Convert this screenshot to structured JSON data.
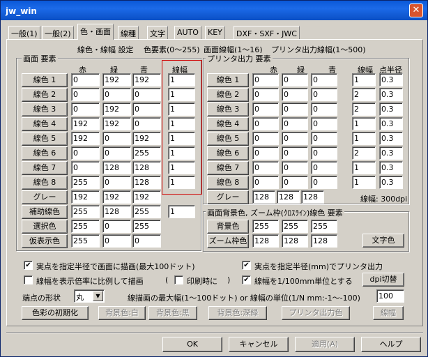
{
  "window": {
    "title": "jw_win",
    "close_glyph": "✕"
  },
  "tabs": [
    "一般(1)",
    "一般(2)",
    "色・画面",
    "線種",
    "文字",
    "AUTO",
    "KEY",
    "DXF・SXF・JWC"
  ],
  "header": {
    "line1": "線色・線幅 設定",
    "line2": "色要素(0〜255)",
    "line3": "画面線幅(1〜16)",
    "line4": "プリンタ出力線幅(1〜500)"
  },
  "screen": {
    "group_label": "画面 要素",
    "col_red": "赤",
    "col_green": "緑",
    "col_blue": "青",
    "col_width": "線幅",
    "rows": [
      {
        "label": "線色 1",
        "r": "0",
        "g": "192",
        "b": "192",
        "w": "1"
      },
      {
        "label": "線色 2",
        "r": "0",
        "g": "0",
        "b": "0",
        "w": "1"
      },
      {
        "label": "線色 3",
        "r": "0",
        "g": "192",
        "b": "0",
        "w": "1"
      },
      {
        "label": "線色 4",
        "r": "192",
        "g": "192",
        "b": "0",
        "w": "1"
      },
      {
        "label": "線色 5",
        "r": "192",
        "g": "0",
        "b": "192",
        "w": "1"
      },
      {
        "label": "線色 6",
        "r": "0",
        "g": "0",
        "b": "255",
        "w": "1"
      },
      {
        "label": "線色 7",
        "r": "0",
        "g": "128",
        "b": "128",
        "w": "1"
      },
      {
        "label": "線色 8",
        "r": "255",
        "g": "0",
        "b": "128",
        "w": "1"
      }
    ],
    "gray": {
      "label": "グレー",
      "r": "192",
      "g": "192",
      "b": "192"
    },
    "aux": {
      "label": "補助線色",
      "r": "255",
      "g": "128",
      "b": "255",
      "w": "1"
    },
    "select": {
      "label": "選択色",
      "r": "255",
      "g": "0",
      "b": "255"
    },
    "temp": {
      "label": "仮表示色",
      "r": "255",
      "g": "0",
      "b": "0"
    }
  },
  "printer": {
    "group_label": "プリンタ出力 要素",
    "col_red": "赤",
    "col_green": "緑",
    "col_blue": "青",
    "col_width": "線幅",
    "col_radius": "点半径",
    "rows": [
      {
        "label": "線色 1",
        "r": "0",
        "g": "0",
        "b": "0",
        "w": "1",
        "p": "0.3"
      },
      {
        "label": "線色 2",
        "r": "0",
        "g": "0",
        "b": "0",
        "w": "2",
        "p": "0.3"
      },
      {
        "label": "線色 3",
        "r": "0",
        "g": "0",
        "b": "0",
        "w": "2",
        "p": "0.3"
      },
      {
        "label": "線色 4",
        "r": "0",
        "g": "0",
        "b": "0",
        "w": "1",
        "p": "0.3"
      },
      {
        "label": "線色 5",
        "r": "0",
        "g": "0",
        "b": "0",
        "w": "1",
        "p": "0.3"
      },
      {
        "label": "線色 6",
        "r": "0",
        "g": "0",
        "b": "0",
        "w": "2",
        "p": "0.3"
      },
      {
        "label": "線色 7",
        "r": "0",
        "g": "0",
        "b": "0",
        "w": "1",
        "p": "0.3"
      },
      {
        "label": "線色 8",
        "r": "0",
        "g": "0",
        "b": "0",
        "w": "1",
        "p": "0.3"
      }
    ],
    "gray": {
      "label": "グレー",
      "r": "128",
      "g": "128",
      "b": "128"
    },
    "dpi_note": "線幅: 300dpi"
  },
  "bg": {
    "group_label": "画面背景色, ズーム枠(ｸﾛｽﾗｲﾝ)線色 要素",
    "bgcolor": {
      "label": "背景色",
      "r": "255",
      "g": "255",
      "b": "255"
    },
    "zoom": {
      "label": "ズーム枠色",
      "r": "128",
      "g": "128",
      "b": "128"
    },
    "text_color_btn": "文字色"
  },
  "options": {
    "chk1": "実点を指定半径で画面に描画(最大100ドット)",
    "chk2": "線幅を表示倍率に比例して描画",
    "chk3": "印刷時に",
    "chk3_paren_open": "(",
    "chk3_paren_close": ")",
    "chk4": "実点を指定半径(mm)でプリンタ出力",
    "chk5": "線幅を1/100mm単位とする",
    "dpi_btn": "dpi切替",
    "endpoint_label": "端点の形状",
    "endpoint_value": "丸",
    "max_width_text": "線描画の最大幅(1〜100ドット) or 線幅の単位(1/N mm:-1〜-100)",
    "max_width_value": "100",
    "check_mark": "✔",
    "dropdown_arrow": "▼"
  },
  "bottom_buttons": {
    "init": "色彩の初期化",
    "bg_white": "背景色:白",
    "bg_black": "背景色:黒",
    "bg_deep": "背景色:深緑",
    "printer_color": "プリンタ出力色",
    "line_width": "線幅"
  },
  "dialog_buttons": {
    "ok": "OK",
    "cancel": "キャンセル",
    "apply": "適用(A)",
    "help": "ヘルプ"
  }
}
